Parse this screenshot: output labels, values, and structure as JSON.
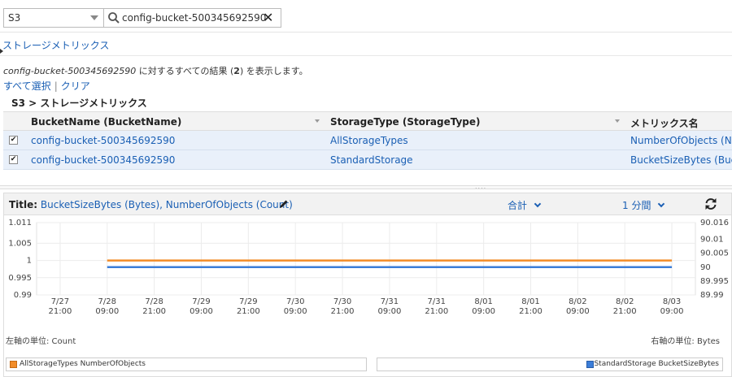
{
  "search": {
    "namespace": "S3",
    "query": "config-bucket-500345692590",
    "clear_glyph": "✕"
  },
  "breadcrumb": {
    "label": "ストレージメトリックス"
  },
  "results": {
    "bucket": "config-bucket-500345692590",
    "text_before_count": " に対するすべての結果 (",
    "count": "2",
    "text_after_count": ") を表示します。"
  },
  "selection": {
    "select_all": "すべて選択",
    "separator": "|",
    "clear": "クリア"
  },
  "grid": {
    "title": "S3 > ストレージメトリックス",
    "columns": [
      "BucketName (BucketName)",
      "StorageType (StorageType)",
      "メトリックス名"
    ],
    "rows": [
      [
        "config-bucket-500345692590",
        "AllStorageTypes",
        "NumberOfObjects (Nu"
      ],
      [
        "config-bucket-500345692590",
        "StandardStorage",
        "BucketSizeBytes (Buc"
      ]
    ],
    "checked": [
      true,
      true
    ]
  },
  "chart": {
    "title_label": "Title:",
    "title_metrics": "BucketSizeBytes (Bytes), NumberOfObjects (Count)",
    "statistic": "合計",
    "period": "1 分間",
    "left_unit": "左軸の単位: Count",
    "right_unit": "右軸の単位: Bytes",
    "legend_left": "AllStorageTypes NumberOfObjects",
    "legend_right": "StandardStorage BucketSizeBytes"
  },
  "chart_data": {
    "type": "line",
    "x": [
      "7/27 21:00",
      "7/28 09:00",
      "7/28 21:00",
      "7/29 09:00",
      "7/29 21:00",
      "7/30 09:00",
      "7/30 21:00",
      "7/31 09:00",
      "7/31 21:00",
      "8/01 09:00",
      "8/01 21:00",
      "8/02 09:00",
      "8/02 21:00",
      "8/03 09:00"
    ],
    "x_ticks": [
      [
        "7/27",
        "21:00"
      ],
      [
        "7/28",
        "09:00"
      ],
      [
        "7/28",
        "21:00"
      ],
      [
        "7/29",
        "09:00"
      ],
      [
        "7/29",
        "21:00"
      ],
      [
        "7/30",
        "09:00"
      ],
      [
        "7/30",
        "21:00"
      ],
      [
        "7/31",
        "09:00"
      ],
      [
        "7/31",
        "21:00"
      ],
      [
        "8/01",
        "09:00"
      ],
      [
        "8/01",
        "21:00"
      ],
      [
        "8/02",
        "09:00"
      ],
      [
        "8/02",
        "21:00"
      ],
      [
        "8/03",
        "09:00"
      ]
    ],
    "y_left_ticks": [
      "1.011",
      "1.005",
      "1",
      "0.995",
      "0.99"
    ],
    "y_right_ticks": [
      "90.016",
      "90.01",
      "90.005",
      "90",
      "89.995",
      "89.99"
    ],
    "y_left_lim": [
      0.99,
      1.011
    ],
    "y_right_lim": [
      89.99,
      90.016
    ],
    "series": [
      {
        "name": "AllStorageTypes NumberOfObjects",
        "axis": "left",
        "color": "#f28c28",
        "x_range": [
          "7/28 09:00",
          "8/03 09:00"
        ],
        "value": 1
      },
      {
        "name": "StandardStorage BucketSizeBytes",
        "axis": "right",
        "color": "#3b7dd8",
        "x_range": [
          "7/28 09:00",
          "8/03 09:00"
        ],
        "value": 90
      }
    ]
  }
}
